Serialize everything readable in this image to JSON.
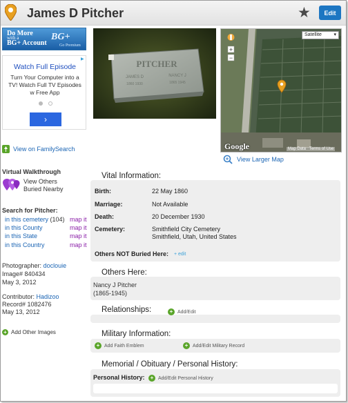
{
  "header": {
    "title": "James D Pitcher",
    "edit_label": "Edit"
  },
  "ads": {
    "banner_line1": "Do More",
    "banner_line2": "with a",
    "banner_line3": "BG+ Account",
    "banner_brand": "BG+",
    "banner_tag": "Go Premium",
    "promo_title": "Watch Full Episode",
    "promo_body": "Turn Your Computer into a TV! Watch Full TV Episodes w Free App",
    "promo_next": "›"
  },
  "sidebar": {
    "familysearch_link": "View on FamilySearch",
    "walkthrough_label": "Virtual Walkthrough",
    "walkthrough_link_line1": "View Others",
    "walkthrough_link_line2": "Buried Nearby",
    "search_prefix": "Search for",
    "search_name": "Pitcher",
    "search_rows": [
      {
        "label": "in this cemetery",
        "count": "(104)",
        "map": "map it"
      },
      {
        "label": "in this County",
        "count": "",
        "map": "map it"
      },
      {
        "label": "in this State",
        "count": "",
        "map": "map it"
      },
      {
        "label": "in this Country",
        "count": "",
        "map": "map it"
      }
    ],
    "photographer_label": "Photographer:",
    "photographer_name": "doclouie",
    "image_number": "Image# 840434",
    "image_date": "May 3, 2012",
    "contributor_label": "Contributor:",
    "contributor_name": "Hadizoo",
    "record_number": "Record# 1082476",
    "record_date": "May 13, 2012",
    "add_images": "Add Other Images"
  },
  "map": {
    "type_select": "Satellite",
    "google_logo": "Google",
    "map_data": "Map Data",
    "terms": "Terms of Use",
    "view_larger": "View Larger Map"
  },
  "vital": {
    "title": "Vital Information:",
    "rows": [
      {
        "key": "Birth:",
        "value": "22 May 1860"
      },
      {
        "key": "Marriage:",
        "value": "Not Available"
      },
      {
        "key": "Death:",
        "value": "20 December 1930"
      }
    ],
    "cemetery_key": "Cemetery:",
    "cemetery_name": "Smithfield City Cemetery",
    "cemetery_location": "Smithfield, Utah, United States",
    "others_not_buried": "Others NOT Buried Here:",
    "others_edit": "+ edit"
  },
  "others_here": {
    "title": "Others Here:",
    "name": "Nancy J Pitcher",
    "years": "(1865-1945)"
  },
  "relationships": {
    "title": "Relationships:",
    "add_edit": "Add/Edit"
  },
  "military": {
    "title": "Military Information:",
    "add_emblem": "Add Faith Emblem",
    "add_military": "Add/Edit Military Record"
  },
  "memorial": {
    "title": "Memorial / Obituary / Personal History:",
    "personal_history": "Personal History:",
    "add_personal": "Add/Edit Personal History"
  },
  "colors": {
    "accent": "#1d76c2",
    "link": "#1a64b4",
    "mapit": "#8a1ea8",
    "plus": "#5aa52a"
  }
}
